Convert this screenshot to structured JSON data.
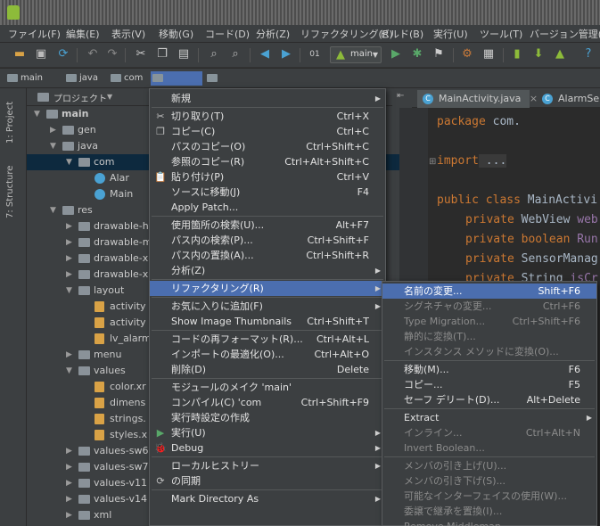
{
  "menubar": [
    "ファイル(F)",
    "編集(E)",
    "表示(V)",
    "移動(G)",
    "コード(D)",
    "分析(Z)",
    "リファクタリング(R)",
    "ビルド(B)",
    "実行(U)",
    "ツール(T)",
    "バージョン管理(S)"
  ],
  "toolbar": {
    "run_config": "main"
  },
  "breadcrumbs": [
    "main",
    "java",
    "com",
    "",
    ""
  ],
  "toolstrip": {
    "project_tab": "1: Project",
    "structure_tab": "7: Structure"
  },
  "project": {
    "header": "プロジェクト",
    "tree": [
      {
        "label": "main",
        "arrow": "▼",
        "icon": "folder"
      },
      {
        "label": "gen",
        "arrow": "▶",
        "icon": "folder"
      },
      {
        "label": "java",
        "arrow": "▼",
        "icon": "folder"
      },
      {
        "label": "com",
        "arrow": "▼",
        "icon": "folder"
      },
      {
        "label": "Alar",
        "arrow": "",
        "icon": "java"
      },
      {
        "label": "Main",
        "arrow": "",
        "icon": "java"
      },
      {
        "label": "res",
        "arrow": "▼",
        "icon": "folder"
      },
      {
        "label": "drawable-h",
        "arrow": "▶",
        "icon": "folder"
      },
      {
        "label": "drawable-m",
        "arrow": "▶",
        "icon": "folder"
      },
      {
        "label": "drawable-x",
        "arrow": "▶",
        "icon": "folder"
      },
      {
        "label": "drawable-x",
        "arrow": "▶",
        "icon": "folder"
      },
      {
        "label": "layout",
        "arrow": "▼",
        "icon": "folder"
      },
      {
        "label": "activity",
        "arrow": "",
        "icon": "file"
      },
      {
        "label": "activity",
        "arrow": "",
        "icon": "file"
      },
      {
        "label": "lv_alarm",
        "arrow": "",
        "icon": "file"
      },
      {
        "label": "menu",
        "arrow": "▶",
        "icon": "folder"
      },
      {
        "label": "values",
        "arrow": "▼",
        "icon": "folder"
      },
      {
        "label": "color.xr",
        "arrow": "",
        "icon": "file"
      },
      {
        "label": "dimens",
        "arrow": "",
        "icon": "file"
      },
      {
        "label": "strings.",
        "arrow": "",
        "icon": "file"
      },
      {
        "label": "styles.x",
        "arrow": "",
        "icon": "file"
      },
      {
        "label": "values-sw6",
        "arrow": "▶",
        "icon": "folder"
      },
      {
        "label": "values-sw7",
        "arrow": "▶",
        "icon": "folder"
      },
      {
        "label": "values-v11",
        "arrow": "▶",
        "icon": "folder"
      },
      {
        "label": "values-v14",
        "arrow": "▶",
        "icon": "folder"
      },
      {
        "label": "xml",
        "arrow": "▶",
        "icon": "folder"
      }
    ]
  },
  "editor": {
    "tabs": [
      "MainActivity.java",
      "AlarmSe"
    ],
    "code": {
      "package_kw": "package",
      "package_name": "com.",
      "import_kw": "import",
      "import_rest": " ...",
      "class_kw": "public class",
      "class_name": " MainActivi",
      "field1_kw": "private",
      "field1_type": " WebView ",
      "field1_name": "web",
      "field2_kw": "private boolean",
      "field2_name": " Run",
      "field3_kw": "private",
      "field3_type": " SensorManag",
      "field4_kw": "private",
      "field4_type": " String ",
      "field4_name": "isCr"
    }
  },
  "context_menu": [
    {
      "label": "新規",
      "shortcut": "",
      "submenu": true,
      "icon": ""
    },
    {
      "sep": true
    },
    {
      "label": "切り取り(T)",
      "shortcut": "Ctrl+X",
      "icon": "✂"
    },
    {
      "label": "コピー(C)",
      "shortcut": "Ctrl+C",
      "icon": "❐"
    },
    {
      "label": "パスのコピー(O)",
      "shortcut": "Ctrl+Shift+C",
      "icon": ""
    },
    {
      "label": "参照のコピー(R)",
      "shortcut": "Ctrl+Alt+Shift+C",
      "icon": ""
    },
    {
      "label": "貼り付け(P)",
      "shortcut": "Ctrl+V",
      "icon": "📋"
    },
    {
      "label": "ソースに移動(J)",
      "shortcut": "F4",
      "icon": ""
    },
    {
      "label": "Apply Patch...",
      "shortcut": "",
      "icon": ""
    },
    {
      "sep": true
    },
    {
      "label": "使用箇所の検索(U)...",
      "shortcut": "Alt+F7",
      "icon": ""
    },
    {
      "label": "パス内の検索(P)...",
      "shortcut": "Ctrl+Shift+F",
      "icon": ""
    },
    {
      "label": "パス内の置換(A)...",
      "shortcut": "Ctrl+Shift+R",
      "icon": ""
    },
    {
      "label": "分析(Z)",
      "shortcut": "",
      "submenu": true,
      "icon": ""
    },
    {
      "sep": true
    },
    {
      "label": "リファクタリング(R)",
      "shortcut": "",
      "submenu": true,
      "highlight": true,
      "icon": ""
    },
    {
      "sep": true
    },
    {
      "label": "お気に入りに追加(F)",
      "shortcut": "",
      "submenu": true,
      "icon": ""
    },
    {
      "label": "Show Image Thumbnails",
      "shortcut": "Ctrl+Shift+T",
      "icon": ""
    },
    {
      "sep": true
    },
    {
      "label": "コードの再フォーマット(R)...",
      "shortcut": "Ctrl+Alt+L",
      "icon": ""
    },
    {
      "label": "インポートの最適化(O)...",
      "shortcut": "Ctrl+Alt+O",
      "icon": ""
    },
    {
      "label": "削除(D)",
      "shortcut": "Delete",
      "icon": ""
    },
    {
      "sep": true
    },
    {
      "label": "モジュールのメイク 'main'",
      "shortcut": "",
      "icon": ""
    },
    {
      "label": "コンパイル(C) 'com",
      "shortcut": "Ctrl+Shift+F9",
      "icon": ""
    },
    {
      "label": "実行時設定の作成",
      "shortcut": "",
      "icon": ""
    },
    {
      "label": "実行(U)",
      "shortcut": "",
      "submenu": true,
      "icon": "▶"
    },
    {
      "label": "Debug",
      "shortcut": "",
      "submenu": true,
      "icon": "🐞"
    },
    {
      "sep": true
    },
    {
      "label": "ローカルヒストリー",
      "shortcut": "",
      "submenu": true,
      "icon": ""
    },
    {
      "label": "の同期",
      "shortcut": "",
      "icon": "⟳"
    },
    {
      "sep": true
    },
    {
      "label": "Mark Directory As",
      "shortcut": "",
      "submenu": true,
      "icon": ""
    }
  ],
  "refactor_menu": [
    {
      "label": "名前の変更...",
      "shortcut": "Shift+F6",
      "highlight": true
    },
    {
      "label": "シグネチャの変更...",
      "shortcut": "Ctrl+F6",
      "disabled": true
    },
    {
      "label": "Type Migration...",
      "shortcut": "Ctrl+Shift+F6",
      "disabled": true
    },
    {
      "label": "静的に変換(T)...",
      "shortcut": "",
      "disabled": true
    },
    {
      "label": "インスタンス メソッドに変換(O)...",
      "shortcut": "",
      "disabled": true
    },
    {
      "sep": true
    },
    {
      "label": "移動(M)...",
      "shortcut": "F6"
    },
    {
      "label": "コピー...",
      "shortcut": "F5"
    },
    {
      "label": "セーフ デリート(D)...",
      "shortcut": "Alt+Delete"
    },
    {
      "sep": true
    },
    {
      "label": "Extract",
      "shortcut": "",
      "submenu": true
    },
    {
      "label": "インライン...",
      "shortcut": "Ctrl+Alt+N",
      "disabled": true
    },
    {
      "label": "Invert Boolean...",
      "shortcut": "",
      "disabled": true
    },
    {
      "sep": true
    },
    {
      "label": "メンバの引き上げ(U)...",
      "shortcut": "",
      "disabled": true
    },
    {
      "label": "メンバの引き下げ(S)...",
      "shortcut": "",
      "disabled": true
    },
    {
      "label": "可能なインターフェイスの使用(W)...",
      "shortcut": "",
      "disabled": true
    },
    {
      "label": "委譲で継承を置換(I)...",
      "shortcut": "",
      "disabled": true
    },
    {
      "label": "Remove Middleman...",
      "shortcut": "",
      "disabled": true
    }
  ]
}
